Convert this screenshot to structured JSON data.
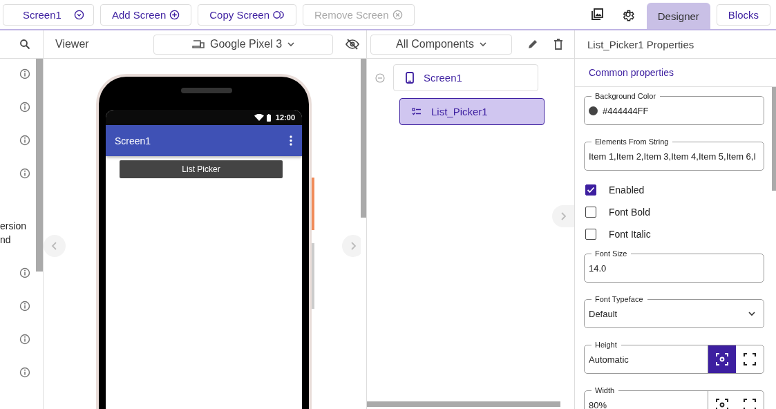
{
  "toolbar": {
    "screen_select": "Screen1",
    "buttons": [
      {
        "label": "Add Screen",
        "kind": "add",
        "disabled": false
      },
      {
        "label": "Copy Screen",
        "kind": "copy",
        "disabled": false
      },
      {
        "label": "Remove Screen",
        "kind": "remove",
        "disabled": true
      }
    ],
    "tabs": [
      {
        "label": "Designer",
        "selected": true
      },
      {
        "label": "Blocks",
        "selected": false
      }
    ]
  },
  "palette": {
    "text_lines": [
      "ersion",
      "nd"
    ]
  },
  "viewer": {
    "title": "Viewer",
    "device": "Google Pixel 3",
    "phone": {
      "time": "12:00",
      "app_title": "Screen1",
      "button": "List Picker"
    }
  },
  "components": {
    "filter": "All Components",
    "tree": [
      {
        "label": "Screen1",
        "expanded": true,
        "selected": false,
        "children": [
          {
            "label": "List_Picker1",
            "selected": true
          }
        ]
      }
    ]
  },
  "properties": {
    "title": "List_Picker1 Properties",
    "section": "Common properties",
    "fields": [
      {
        "kind": "color",
        "label": "Background Color",
        "value": "#444444FF",
        "color": "#444444"
      },
      {
        "kind": "text",
        "label": "Elements From String",
        "value": "Item 1,Item 2,Item 3,Item 4,Item 5,Item 6,I"
      },
      {
        "kind": "checkbox",
        "label": "Enabled",
        "checked": true
      },
      {
        "kind": "checkbox",
        "label": "Font Bold",
        "checked": false
      },
      {
        "kind": "checkbox",
        "label": "Font Italic",
        "checked": false
      },
      {
        "kind": "text",
        "label": "Font Size",
        "value": "14.0"
      },
      {
        "kind": "select",
        "label": "Font Typeface",
        "value": "Default"
      },
      {
        "kind": "size",
        "label": "Height",
        "value": "Automatic",
        "modes": [
          {
            "selected": true
          },
          {
            "selected": false
          }
        ]
      },
      {
        "kind": "size",
        "label": "Width",
        "value": "80%",
        "modes": [
          {
            "selected": false
          },
          {
            "selected": false
          }
        ]
      }
    ]
  }
}
